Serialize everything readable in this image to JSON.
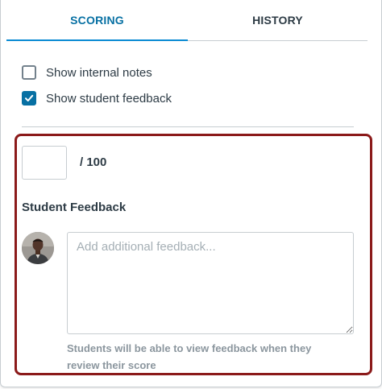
{
  "tabs": [
    {
      "label": "SCORING",
      "active": true
    },
    {
      "label": "HISTORY",
      "active": false
    }
  ],
  "options": {
    "show_internal_notes": {
      "label": "Show internal notes",
      "checked": false
    },
    "show_student_feedback": {
      "label": "Show student feedback",
      "checked": true
    }
  },
  "score": {
    "value": "",
    "total_label": "/ 100"
  },
  "feedback": {
    "heading": "Student Feedback",
    "placeholder": "Add additional feedback...",
    "helper_text": "Students will be able to view feedback when they review their score"
  },
  "colors": {
    "accent": "#0770a3",
    "highlight_border": "#8b1a1a",
    "text": "#2d3b45",
    "muted": "#8b969e"
  },
  "icons": {
    "checkmark": "check-icon",
    "avatar": "user-avatar"
  }
}
